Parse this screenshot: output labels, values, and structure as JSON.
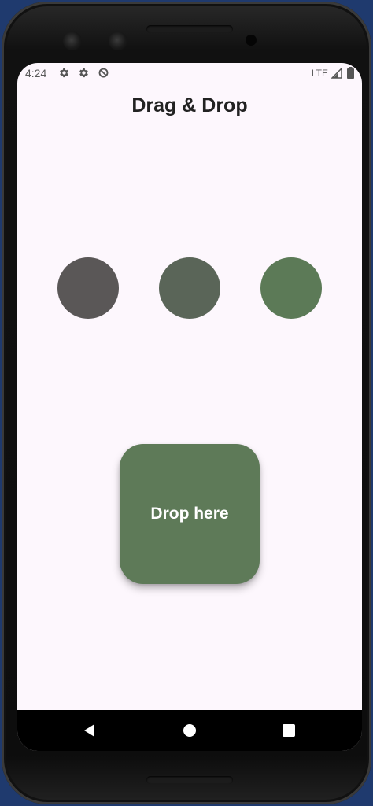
{
  "status_bar": {
    "time": "4:24",
    "network": "LTE",
    "icons": [
      "settings-icon",
      "settings-icon",
      "data-saver-icon",
      "signal-icon",
      "battery-icon"
    ]
  },
  "app": {
    "title": "Drag & Drop"
  },
  "draggables": [
    {
      "name": "draggable-circle-dark-gray",
      "color": "#5a5757"
    },
    {
      "name": "draggable-circle-gray-green",
      "color": "#5a6558"
    },
    {
      "name": "draggable-circle-green",
      "color": "#5c7a57"
    }
  ],
  "drop_target": {
    "label": "Drop here",
    "color": "#5e7a58"
  },
  "nav_bar": {
    "icons": [
      "back-icon",
      "home-icon",
      "recent-apps-icon"
    ]
  }
}
